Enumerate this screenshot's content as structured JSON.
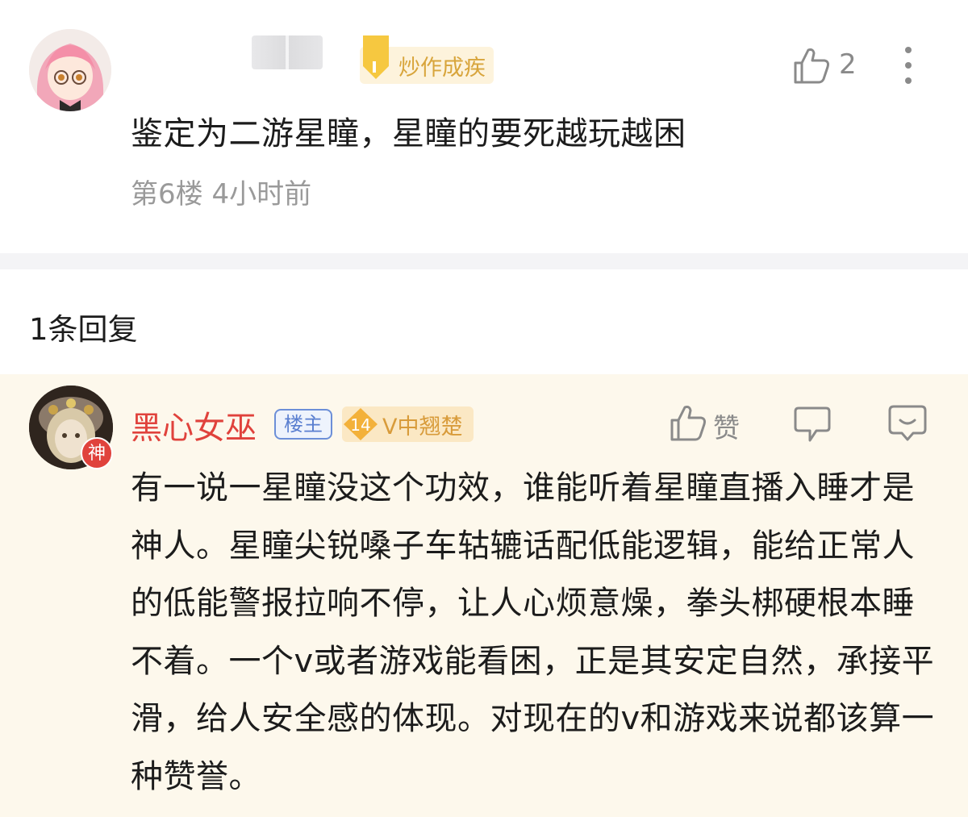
{
  "comment": {
    "username_badge": "炒作成疾",
    "text": "鉴定为二游星瞳，星瞳的要死越玩越困",
    "meta": "第6楼 4小时前",
    "like_count": "2",
    "icons": [
      "like-icon",
      "more-icon"
    ]
  },
  "replies_header": "1条回复",
  "reply": {
    "username": "黑心女巫",
    "avatar_badge": "神",
    "op_badge": "楼主",
    "level": "14",
    "level_badge": "V中翘楚",
    "like_label": "赞",
    "text": "有一说一星瞳没这个功效，谁能听着星瞳直播入睡才是神人。星瞳尖锐嗓子车轱辘话配低能逻辑，能给正常人的低能警报拉响不停，让人心烦意燥，拳头梆硬根本睡不着。一个v或者游戏能看困，正是其安定自然，承接平滑，给人安全感的体现。对现在的v和游戏来说都该算一种赞誉。",
    "icons": [
      "like-icon",
      "reply-icon",
      "emoji-icon"
    ]
  },
  "colors": {
    "username_red": "#e0423c",
    "reply_background": "#fdf8ec",
    "badge_gold": "#d8a53c",
    "op_blue": "#5a7fd0",
    "meta_gray": "#9a9a9a"
  }
}
